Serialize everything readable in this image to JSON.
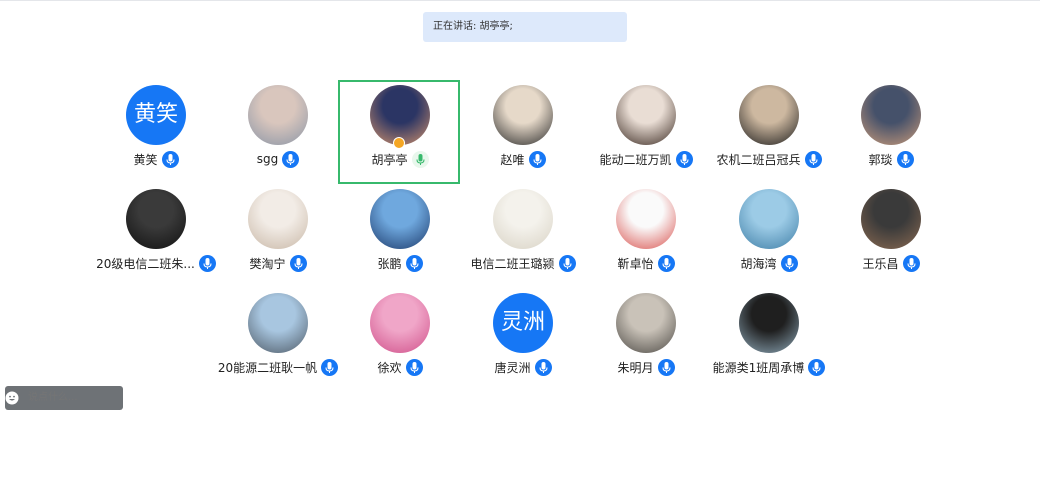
{
  "banner": {
    "speaking_text": "正在讲话: 胡亭亭;"
  },
  "participants": [
    {
      "name": "黄笑",
      "avatar_text": "黄笑",
      "avatar_type": "text",
      "mic": "muted"
    },
    {
      "name": "sgg",
      "avatar_type": "photo",
      "mic": "muted",
      "photo": [
        "#d9c6bd",
        "#8a95a6"
      ]
    },
    {
      "name": "胡亭亭",
      "avatar_type": "photo",
      "mic": "speaking",
      "host": true,
      "photo": [
        "#2b3564",
        "#d3936c"
      ]
    },
    {
      "name": "赵唯",
      "avatar_type": "photo",
      "mic": "muted",
      "photo": [
        "#e6d9c9",
        "#2a2a2a"
      ]
    },
    {
      "name": "能动二班万凯",
      "avatar_type": "photo",
      "mic": "muted",
      "photo": [
        "#e9ddd4",
        "#3a2a22"
      ]
    },
    {
      "name": "农机二班吕冠兵",
      "avatar_type": "photo",
      "mic": "muted",
      "photo": [
        "#cdb8a0",
        "#1b1b1b"
      ]
    },
    {
      "name": "郭琰",
      "avatar_type": "photo",
      "mic": "muted",
      "photo": [
        "#45516a",
        "#c99b7a"
      ]
    },
    {
      "name": "20级电信二班朱...",
      "avatar_type": "photo",
      "mic": "muted",
      "photo": [
        "#3a3a3a",
        "#101010"
      ]
    },
    {
      "name": "樊淘宁",
      "avatar_type": "photo",
      "mic": "muted",
      "photo": [
        "#f2ece6",
        "#c8b7a6"
      ]
    },
    {
      "name": "张鹏",
      "avatar_type": "photo",
      "mic": "muted",
      "photo": [
        "#6fa8de",
        "#1c3a6b"
      ]
    },
    {
      "name": "电信二班王璐颍",
      "avatar_type": "photo",
      "mic": "muted",
      "photo": [
        "#f4f2ec",
        "#d8d2c4"
      ]
    },
    {
      "name": "靳卓怡",
      "avatar_type": "photo",
      "mic": "muted",
      "photo": [
        "#fafafa",
        "#d9534f"
      ]
    },
    {
      "name": "胡海湾",
      "avatar_type": "photo",
      "mic": "muted",
      "photo": [
        "#9ccbe6",
        "#3f7ea6"
      ]
    },
    {
      "name": "王乐昌",
      "avatar_type": "photo",
      "mic": "muted",
      "photo": [
        "#3a3a3a",
        "#8a6a52"
      ]
    },
    {
      "name": "20能源二班耿一帆",
      "avatar_type": "photo",
      "mic": "muted",
      "photo": [
        "#a8c6e0",
        "#4e5a66"
      ]
    },
    {
      "name": "徐欢",
      "avatar_type": "photo",
      "mic": "muted",
      "photo": [
        "#f0a6c8",
        "#d0508a"
      ]
    },
    {
      "name": "唐灵洲",
      "avatar_text": "灵洲",
      "avatar_type": "text",
      "mic": "muted"
    },
    {
      "name": "朱明月",
      "avatar_type": "photo",
      "mic": "muted",
      "photo": [
        "#c9c2b8",
        "#4d4a45"
      ]
    },
    {
      "name": "能源类1班周承博",
      "avatar_type": "photo",
      "mic": "muted",
      "photo": [
        "#1f1f1f",
        "#8ea8b8"
      ]
    }
  ],
  "chat": {
    "placeholder": "说点什么..."
  },
  "colors": {
    "accent": "#1677f5",
    "speaking": "#37b96c",
    "banner_bg": "#dde9fb"
  }
}
